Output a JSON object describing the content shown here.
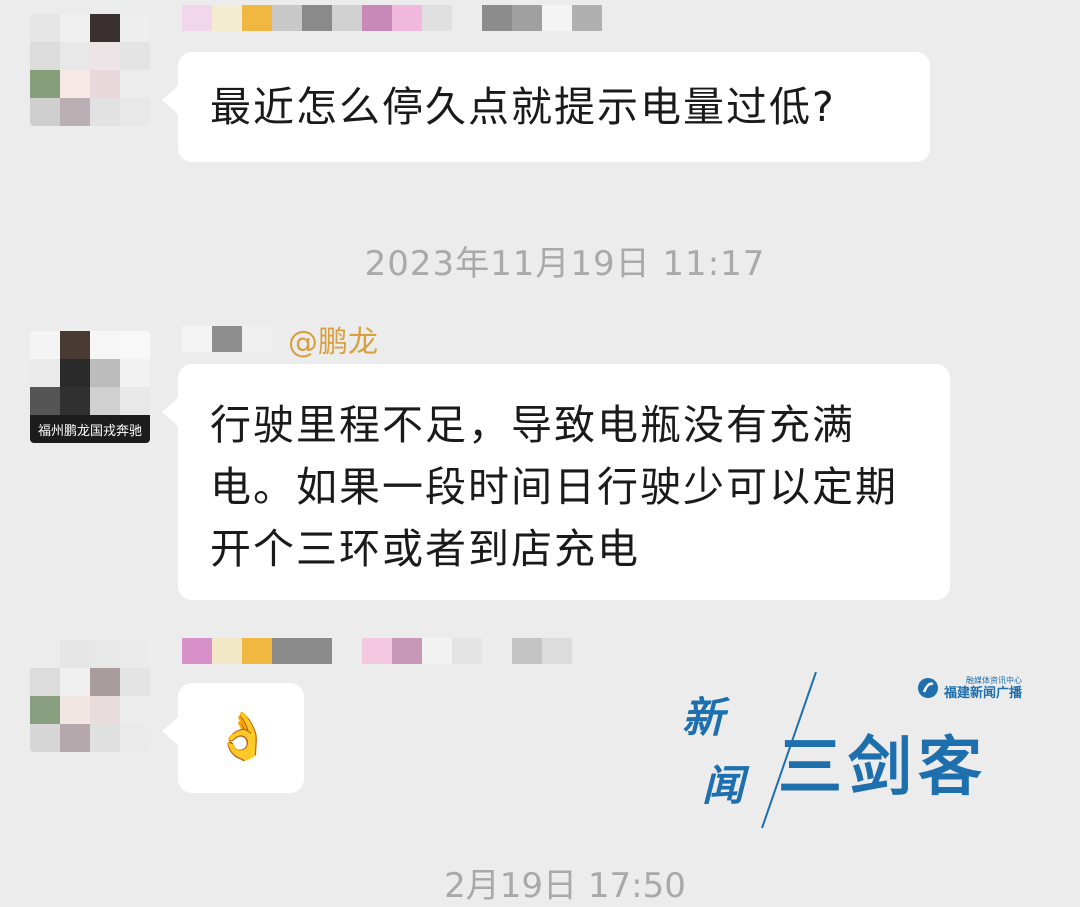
{
  "messages": [
    {
      "text": "最近怎么停久点就提示电量过低?"
    },
    {
      "mention": "@鹏龙",
      "avatar_caption": "福州鹏龙国戎奔驰",
      "text": "行驶里程不足，导致电瓶没有充满电。如果一段时间日行驶少可以定期开个三环或者到店充电"
    },
    {
      "emoji": "👌"
    }
  ],
  "timestamps": {
    "mid": "2023年11月19日 11:17",
    "bottom_partial": "2月19日 17:50"
  },
  "watermark": {
    "xin": "新",
    "wen": "闻",
    "main": "三剑客",
    "brand_sub": "融媒体资讯中心",
    "brand_name": "福建新闻广播",
    "color": "#1e6fae"
  },
  "colors": {
    "background": "#ececec",
    "bubble": "#ffffff",
    "mention": "#d9a040",
    "timestamp": "#a9a9a9"
  }
}
